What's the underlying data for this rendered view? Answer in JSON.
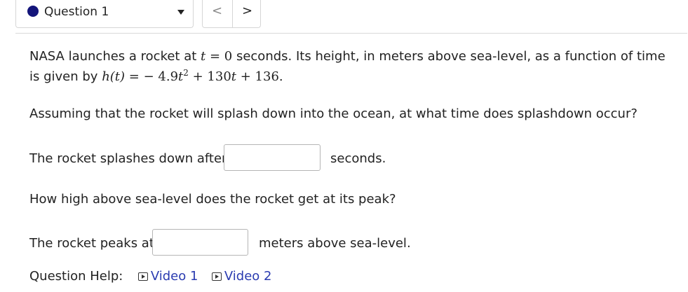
{
  "header": {
    "question_label": "Question 1",
    "prev_label": "<",
    "next_label": ">"
  },
  "problem": {
    "intro_a": "NASA launches a rocket at ",
    "intro_t": "t",
    "intro_eq": " = 0",
    "intro_b": " seconds. Its height, in meters above sea-level, as a function of time",
    "line2_a": "is given by ",
    "line2_ht": "h(t)",
    "line2_eq": " =  − 4.9",
    "line2_t": "t",
    "line2_exp": "2",
    "line2_plus": " + 130",
    "line2_t2": "t",
    "line2_tail": " + 136.",
    "question": "Assuming that the rocket will splash down into the ocean, at what time does splashdown occur?"
  },
  "part1": {
    "prefix": "The rocket splashes down after",
    "input_value": "",
    "suffix": "seconds."
  },
  "part2": {
    "question": "How high above sea-level does the rocket get at its peak?",
    "prefix": "The rocket peaks at",
    "input_value": "",
    "suffix": "meters above sea-level."
  },
  "help": {
    "label": "Question Help:",
    "video1": "Video 1",
    "video2": "Video 2"
  }
}
